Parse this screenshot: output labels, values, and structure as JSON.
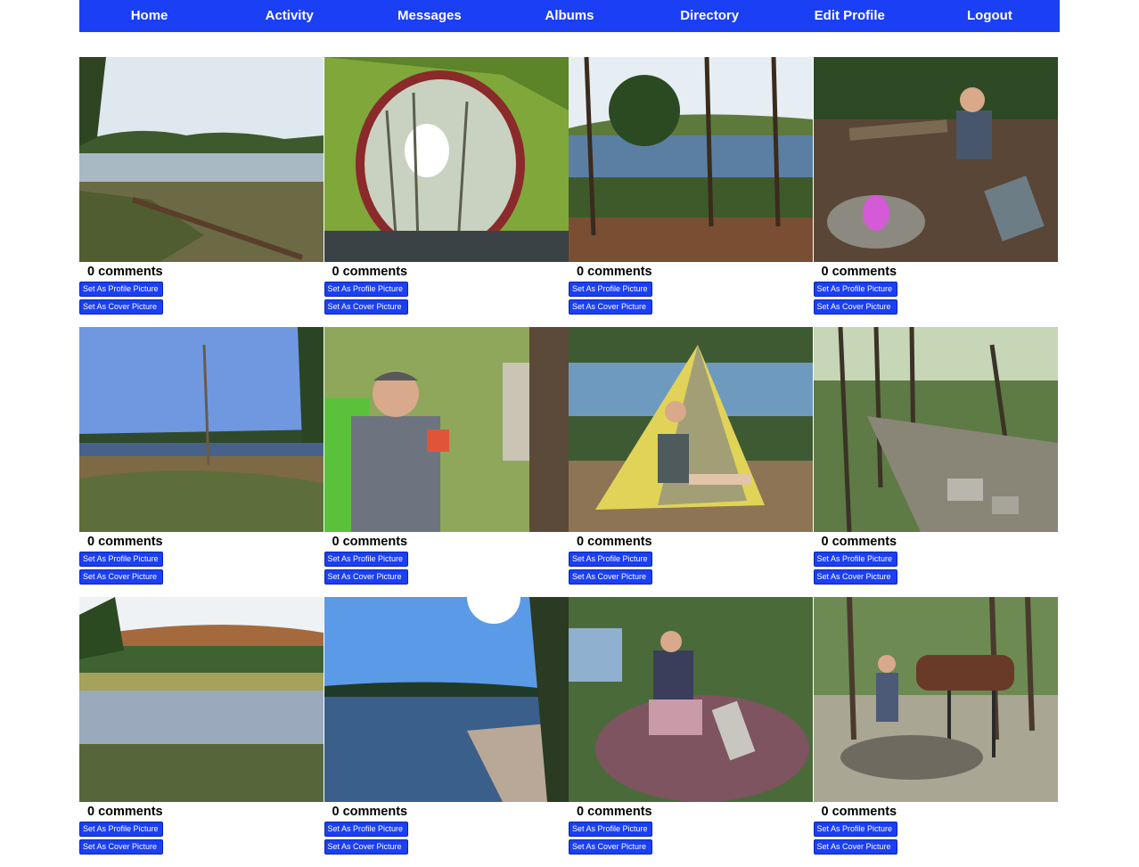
{
  "nav": {
    "home": "Home",
    "activity": "Activity",
    "messages": "Messages",
    "albums": "Albums",
    "directory": "Directory",
    "edit_profile": "Edit Profile",
    "logout": "Logout"
  },
  "photos": [
    {
      "comments": "0 comments",
      "profile_btn": "Set As Profile Picture",
      "cover_btn": "Set As Cover Picture"
    },
    {
      "comments": "0 comments",
      "profile_btn": "Set As Profile Picture",
      "cover_btn": "Set As Cover Picture"
    },
    {
      "comments": "0 comments",
      "profile_btn": "Set As Profile Picture",
      "cover_btn": "Set As Cover Picture"
    },
    {
      "comments": "0 comments",
      "profile_btn": "Set As Profile Picture",
      "cover_btn": "Set As Cover Picture"
    },
    {
      "comments": "0 comments",
      "profile_btn": "Set As Profile Picture",
      "cover_btn": "Set As Cover Picture"
    },
    {
      "comments": "0 comments",
      "profile_btn": "Set As Profile Picture",
      "cover_btn": "Set As Cover Picture"
    },
    {
      "comments": "0 comments",
      "profile_btn": "Set As Profile Picture",
      "cover_btn": "Set As Cover Picture"
    },
    {
      "comments": "0 comments",
      "profile_btn": "Set As Profile Picture",
      "cover_btn": "Set As Cover Picture"
    },
    {
      "comments": "0 comments",
      "profile_btn": "Set As Profile Picture",
      "cover_btn": "Set As Cover Picture"
    },
    {
      "comments": "0 comments",
      "profile_btn": "Set As Profile Picture",
      "cover_btn": "Set As Cover Picture"
    },
    {
      "comments": "0 comments",
      "profile_btn": "Set As Profile Picture",
      "cover_btn": "Set As Cover Picture"
    },
    {
      "comments": "0 comments",
      "profile_btn": "Set As Profile Picture",
      "cover_btn": "Set As Cover Picture"
    }
  ],
  "colors": {
    "nav_bg": "#1a3ff5",
    "button_bg": "#1a3ff5"
  }
}
